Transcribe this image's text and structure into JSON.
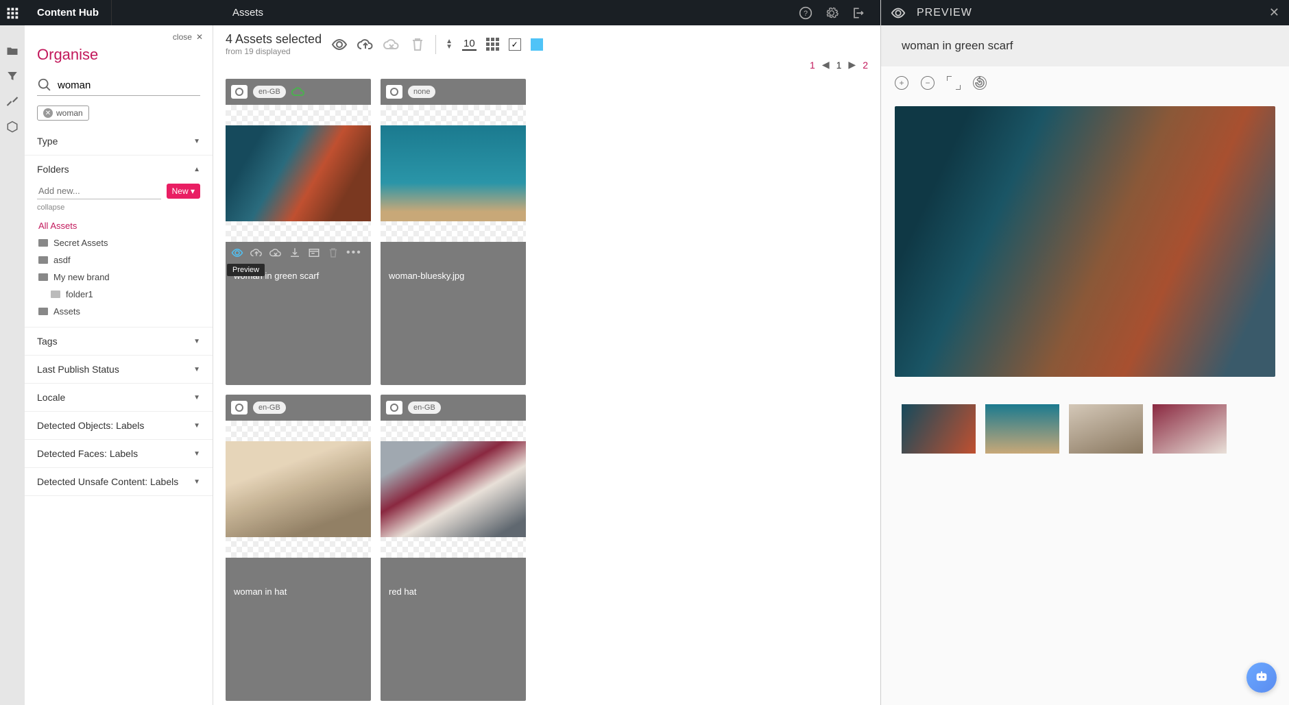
{
  "brand": "Content Hub",
  "page_title": "Assets",
  "close_label": "close",
  "organise_title": "Organise",
  "search": {
    "value": "woman",
    "chip": "woman"
  },
  "facets": {
    "type": "Type",
    "folders": "Folders",
    "tags": "Tags",
    "last_publish": "Last Publish Status",
    "locale": "Locale",
    "detected_objects": "Detected Objects: Labels",
    "detected_faces": "Detected Faces: Labels",
    "detected_unsafe": "Detected Unsafe Content: Labels"
  },
  "folders": {
    "add_placeholder": "Add new...",
    "new_btn": "New ▾",
    "collapse": "collapse",
    "all": "All Assets",
    "items": [
      "Secret Assets",
      "asdf",
      "My new brand"
    ],
    "sub": "folder1",
    "last": "Assets"
  },
  "toolbar": {
    "selected": "4 Assets selected",
    "from": "from 19 displayed",
    "page_size": "10"
  },
  "pager": {
    "p1": "1",
    "cur": "1",
    "p2": "2"
  },
  "cards": [
    {
      "locale": "en-GB",
      "title": "woman in green scarf",
      "cloud": true,
      "active": true
    },
    {
      "locale": "none",
      "title": "woman-bluesky.jpg"
    },
    {
      "locale": "en-GB",
      "title": "woman in hat"
    },
    {
      "locale": "en-GB",
      "title": "red hat"
    }
  ],
  "tooltip": "Preview",
  "preview": {
    "title": "PREVIEW",
    "asset_title": "woman in green scarf"
  }
}
